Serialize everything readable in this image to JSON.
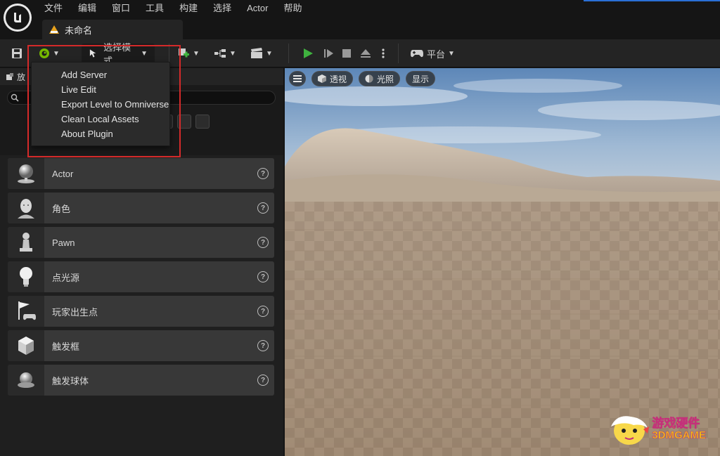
{
  "menubar": {
    "items": [
      "文件",
      "编辑",
      "窗口",
      "工具",
      "构建",
      "选择",
      "Actor",
      "帮助"
    ]
  },
  "document_tab": {
    "title": "未命名"
  },
  "toolbar": {
    "mode_label": "选择模式",
    "platform_label": "平台"
  },
  "left_panel": {
    "header_label": "放",
    "items": [
      {
        "label": "Actor"
      },
      {
        "label": "角色"
      },
      {
        "label": "Pawn"
      },
      {
        "label": "点光源"
      },
      {
        "label": "玩家出生点"
      },
      {
        "label": "触发框"
      },
      {
        "label": "触发球体"
      }
    ],
    "help_glyph": "?"
  },
  "omniverse_menu": {
    "items": [
      "Add Server",
      "Live Edit",
      "Export Level to Omniverse",
      "Clean Local Assets",
      "About Plugin"
    ]
  },
  "viewport": {
    "perspective_label": "透视",
    "lighting_label": "光照",
    "show_label": "显示"
  },
  "watermark": {
    "cn": "游戏硬件",
    "en": "3DMGAME"
  },
  "colors": {
    "highlight_box": "#d42a2a",
    "play_green": "#3fb23f"
  }
}
